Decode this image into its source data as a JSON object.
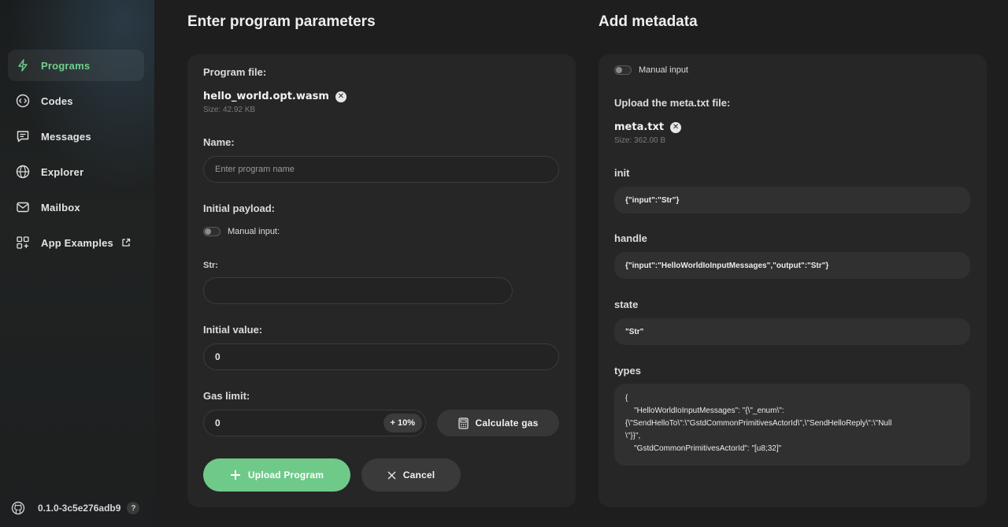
{
  "sidebar": {
    "items": [
      {
        "label": "Programs",
        "icon": "lightning-icon",
        "active": true
      },
      {
        "label": "Codes",
        "icon": "code-icon"
      },
      {
        "label": "Messages",
        "icon": "message-icon"
      },
      {
        "label": "Explorer",
        "icon": "globe-icon"
      },
      {
        "label": "Mailbox",
        "icon": "mail-icon"
      },
      {
        "label": "App Examples",
        "icon": "apps-icon",
        "external": true
      }
    ],
    "version": "0.1.0-3c5e276adb9",
    "help": "?"
  },
  "program": {
    "heading": "Enter program parameters",
    "file_label": "Program file:",
    "file_name": "hello_world.opt.wasm",
    "file_size": "Size: 42.92 KB",
    "name_label": "Name:",
    "name_placeholder": "Enter program name",
    "payload_label": "Initial payload:",
    "manual_input_label": "Manual input:",
    "str_label": "Str:",
    "str_value": "",
    "value_label": "Initial value:",
    "value": "0",
    "gas_label": "Gas limit:",
    "gas_value": "0",
    "gas_increase": "+ 10%",
    "calculate_gas": "Calculate gas",
    "upload": "Upload Program",
    "cancel": "Cancel"
  },
  "metadata": {
    "heading": "Add metadata",
    "manual_input_label": "Manual input",
    "upload_label": "Upload the meta.txt file:",
    "file_name": "meta.txt",
    "file_size": "Size: 362.00 B",
    "init_label": "init",
    "init_value": "{\"input\":\"Str\"}",
    "handle_label": "handle",
    "handle_value": "{\"input\":\"HelloWorldIoInputMessages\",\"output\":\"Str\"}",
    "state_label": "state",
    "state_value": "\"Str\"",
    "types_label": "types",
    "types_value": "{\n    \"HelloWorldIoInputMessages\": \"{\\\"_enum\\\":\n{\\\"SendHelloTo\\\":\\\"GstdCommonPrimitivesActorId\\\",\\\"SendHelloReply\\\":\\\"Null\n\\\"}}\",\n    \"GstdCommonPrimitivesActorId\": \"[u8;32]\""
  },
  "colors": {
    "accent": "#6fca89",
    "background": "#1e1e1e",
    "card": "#262626"
  }
}
